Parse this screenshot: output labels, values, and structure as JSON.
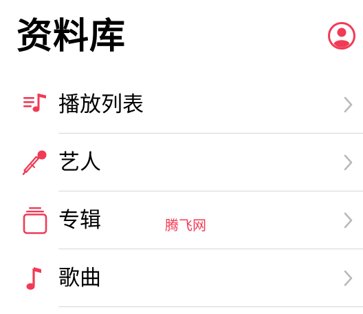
{
  "header": {
    "title": "资料库",
    "profile_icon": "person-circle-icon"
  },
  "accent_color": "#f13a55",
  "library": {
    "items": [
      {
        "label": "播放列表",
        "icon": "playlist-icon"
      },
      {
        "label": "艺人",
        "icon": "microphone-icon"
      },
      {
        "label": "专辑",
        "icon": "album-stack-icon"
      },
      {
        "label": "歌曲",
        "icon": "music-note-icon"
      }
    ],
    "chevron_icon": "chevron-right-icon"
  },
  "watermark": "腾飞网"
}
